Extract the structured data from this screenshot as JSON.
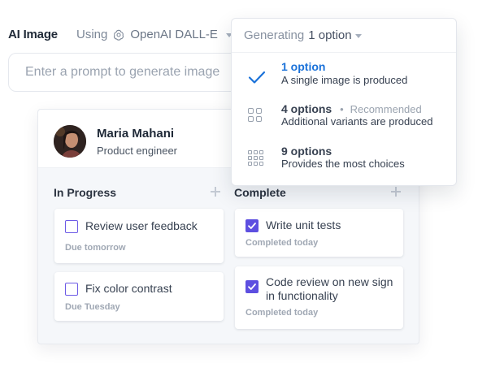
{
  "header": {
    "title": "AI Image",
    "using_label": "Using",
    "model_name": "OpenAI DALL-E"
  },
  "prompt": {
    "placeholder": "Enter a prompt to generate image"
  },
  "dropdown": {
    "label": "Generating",
    "value": "1 option",
    "options": [
      {
        "title": "1 option",
        "desc": "A single image is produced",
        "tag": "",
        "icon": "check-icon",
        "selected": true
      },
      {
        "title": "4 options",
        "desc": "Additional variants are produced",
        "tag": "Recommended",
        "icon": "grid-2x2-icon",
        "selected": false
      },
      {
        "title": "9 options",
        "desc": "Provides the most choices",
        "tag": "",
        "icon": "grid-3x3-icon",
        "selected": false
      }
    ]
  },
  "board": {
    "user": {
      "name": "Maria Mahani",
      "role": "Product engineer"
    },
    "columns": [
      {
        "title": "In Progress",
        "tasks": [
          {
            "text": "Review user feedback",
            "sub": "Due tomorrow",
            "done": false
          },
          {
            "text": "Fix color contrast",
            "sub": "Due Tuesday",
            "done": false
          }
        ]
      },
      {
        "title": "Complete",
        "tasks": [
          {
            "text": "Write unit tests",
            "sub": "Completed today",
            "done": true
          },
          {
            "text": "Code review on new sign in functionality",
            "sub": "Completed today",
            "done": true
          }
        ]
      }
    ]
  },
  "colors": {
    "accent": "#5d4fe0",
    "selected_option": "#1b72d9"
  }
}
